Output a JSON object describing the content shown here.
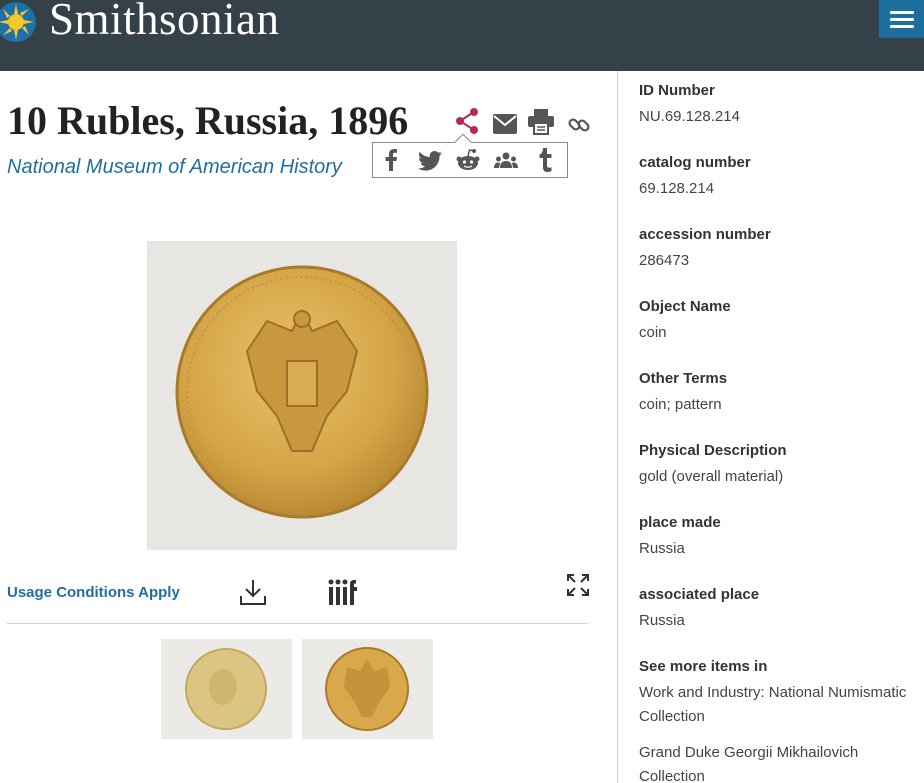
{
  "header": {
    "brand": "Smithsonian",
    "logo_icon": "sun-logo-icon",
    "menu_icon": "hamburger-menu-icon",
    "bg_color": "#344149",
    "accent_color": "#1c6f9c"
  },
  "object": {
    "title": "10 Rubles, Russia, 1896",
    "museum": "National Museum of American History"
  },
  "toolbar": {
    "icons": [
      "share-icon",
      "email-icon",
      "print-icon",
      "link-icon"
    ]
  },
  "share_menu": {
    "icons": [
      "facebook-icon",
      "twitter-icon",
      "reddit-icon",
      "community-icon",
      "tumblr-icon"
    ]
  },
  "media": {
    "usage_label": "Usage Conditions Apply",
    "download_icon": "download-icon",
    "iiif_label": "iiif",
    "fullscreen_icon": "fullscreen-icon"
  },
  "sidebar": {
    "fields": [
      {
        "label": "ID Number",
        "value": "NU.69.128.214"
      },
      {
        "label": "catalog number",
        "value": "69.128.214"
      },
      {
        "label": "accession number",
        "value": "286473"
      },
      {
        "label": "Object Name",
        "value": "coin"
      },
      {
        "label": "Other Terms",
        "value": "coin; pattern"
      },
      {
        "label": "Physical Description",
        "value": "gold (overall material)"
      },
      {
        "label": "place made",
        "value": "Russia"
      },
      {
        "label": "associated place",
        "value": "Russia"
      }
    ],
    "see_more": {
      "label": "See more items in",
      "items": [
        {
          "line1": "Work and Industry: National Numismatic",
          "line2": "Collection"
        },
        {
          "line1": "Grand Duke Georgii Mikhailovich",
          "line2": "Collection"
        }
      ]
    }
  }
}
